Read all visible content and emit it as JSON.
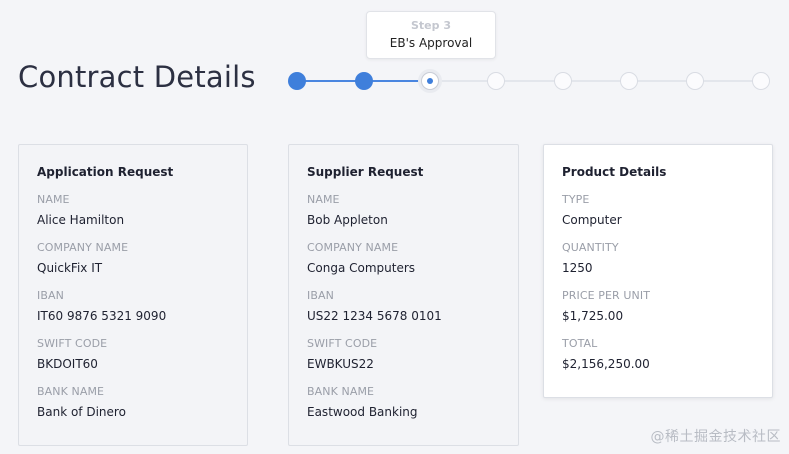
{
  "page": {
    "title": "Contract Details"
  },
  "stepper": {
    "tooltip": {
      "step": "Step 3",
      "label": "EB's Approval"
    },
    "steps": [
      "done",
      "done",
      "current",
      "pending",
      "pending",
      "pending",
      "pending",
      "pending"
    ]
  },
  "cards": {
    "application": {
      "title": "Application Request",
      "fields": [
        {
          "label": "NAME",
          "value": "Alice Hamilton"
        },
        {
          "label": "COMPANY NAME",
          "value": "QuickFix IT"
        },
        {
          "label": "IBAN",
          "value": "IT60 9876 5321 9090"
        },
        {
          "label": "SWIFT CODE",
          "value": "BKDOIT60"
        },
        {
          "label": "BANK NAME",
          "value": "Bank of Dinero"
        }
      ]
    },
    "supplier": {
      "title": "Supplier Request",
      "fields": [
        {
          "label": "NAME",
          "value": "Bob Appleton"
        },
        {
          "label": "COMPANY NAME",
          "value": "Conga Computers"
        },
        {
          "label": "IBAN",
          "value": "US22 1234 5678 0101"
        },
        {
          "label": "SWIFT CODE",
          "value": "EWBKUS22"
        },
        {
          "label": "BANK NAME",
          "value": "Eastwood Banking"
        }
      ]
    },
    "product": {
      "title": "Product Details",
      "fields": [
        {
          "label": "TYPE",
          "value": "Computer"
        },
        {
          "label": "QUANTITY",
          "value": "1250"
        },
        {
          "label": "PRICE PER UNIT",
          "value": "$1,725.00"
        },
        {
          "label": "TOTAL",
          "value": "$2,156,250.00"
        }
      ]
    }
  },
  "watermark": "@稀土掘金技术社区"
}
